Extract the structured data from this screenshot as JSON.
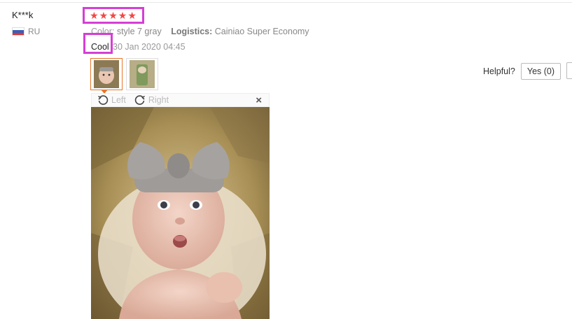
{
  "review": {
    "user_name": "K***k",
    "country": "RU",
    "rating": 5,
    "stars_text": "★★★★★",
    "color_label": "Color:",
    "color_value": "style 7 gray",
    "logistics_label": "Logistics:",
    "logistics_value": "Cainiao Super Economy",
    "feedback": "Cool",
    "date": "30 Jan 2020 04:45"
  },
  "helpful": {
    "label": "Helpful?",
    "yes_label": "Yes (0)"
  },
  "viewer": {
    "rotate_left_label": "Left",
    "rotate_right_label": "Right",
    "close_glyph": "×"
  },
  "colors": {
    "star": "#f04848",
    "highlight_box": "#d63ed6",
    "active_thumb": "#e8762a"
  },
  "icons": [
    "flag-ru-icon",
    "rotate-left-icon",
    "rotate-right-icon",
    "close-icon"
  ]
}
